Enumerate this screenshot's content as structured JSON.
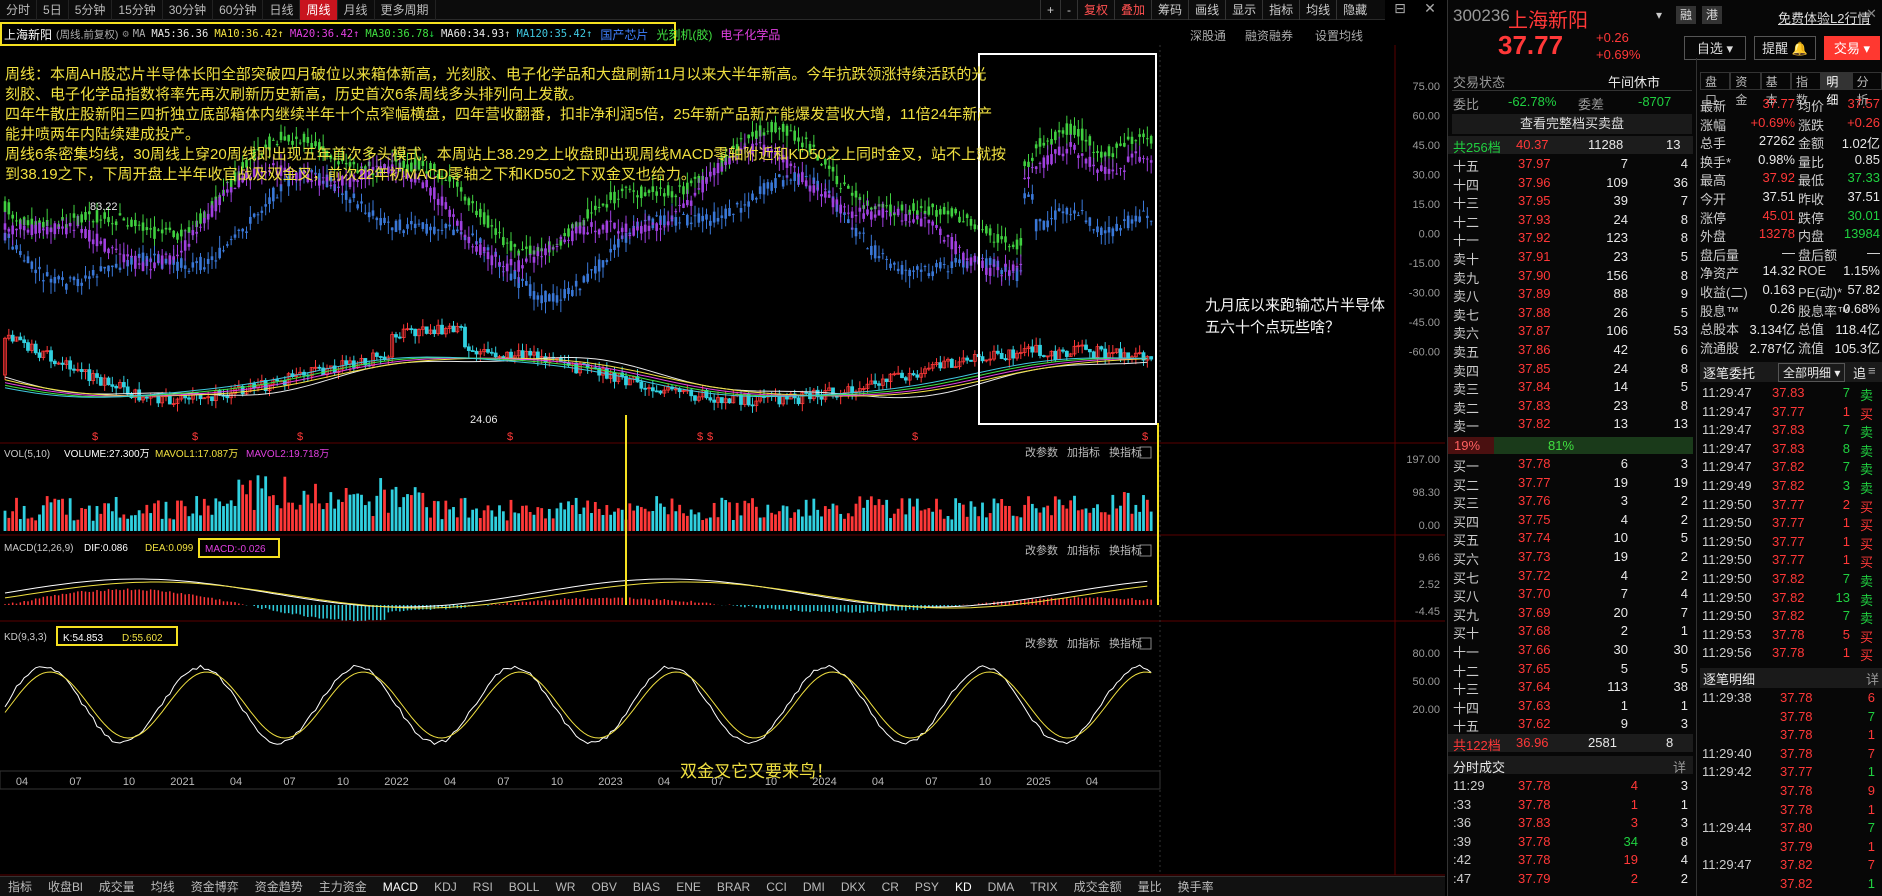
{
  "periods": [
    "分时",
    "5日",
    "5分钟",
    "15分钟",
    "30分钟",
    "60分钟",
    "日线",
    "周线",
    "月线",
    "更多周期"
  ],
  "active_period": "周线",
  "right_tools": [
    "+",
    "-",
    "复权",
    "叠加",
    "筹码",
    "画线",
    "显示",
    "指标",
    "均线",
    "隐藏"
  ],
  "ma_line": {
    "name": "上海新阳",
    "mode": "(周线,前复权)",
    "ma5": "MA5:36.36",
    "ma10": "MA10:36.42",
    "ma20": "MA20:36.42",
    "ma30": "MA30:36.78",
    "ma60": "MA60:34.93",
    "ma120": "MA120:35.42"
  },
  "concept_tags": [
    "国产芯片",
    "光刻机(胶)",
    "电子化学品"
  ],
  "chart_top_links": [
    "深股通",
    "融资融券",
    "设置均线"
  ],
  "annotation_lines": [
    "周线：本周AH股芯片半导体长阳全部突破四月破位以来箱体新高，光刻胶、电子化学品和大盘刷新11月以来大半年新高。今年抗跌领涨持续活跃的光",
    "刻胶、电子化学品指数将率先再次刷新历史新高，历史首次6条周线多头排列向上发散。",
    "四年牛散庄股新阳三四折独立底部箱体内继续半年十个点窄幅横盘，四年营收翻番，扣非净利润5倍，25年新产品新产能爆发营收大增，11倍24年新产",
    "能井喷两年内陆续建成投产。",
    "周线6条密集均线，30周线上穿20周线即出现五年首次多头模式，本周站上38.29之上收盘即出现周线MACD零轴附近和KD50之上同时金叉，站不上就按",
    "到38.19之下，下周开盘上半年收官战及双金叉，前次22年初MACD零轴之下和KD50之下双金叉也给力。"
  ],
  "note_box": "九月底以来跑输芯片半导体五六十个点玩些啥？",
  "note_kd": "双金叉它又要来鸟！",
  "price_labels": {
    "high": "83.22",
    "low": "24.06"
  },
  "overlay_axis": [
    "75.00",
    "60.00",
    "45.00",
    "30.00",
    "15.00",
    "0.00",
    "-15.00",
    "-30.00",
    "-45.00",
    "-60.00"
  ],
  "vol": {
    "title": "VOL(5,10)",
    "volume": "VOLUME:27.300万",
    "mavol1": "MAVOL1:17.087万",
    "mavol2": "MAVOL2:19.718万",
    "axis": [
      "197.00",
      "98.30",
      "0.00"
    ]
  },
  "macd": {
    "title": "MACD(12,26,9)",
    "dif": "DIF:0.086",
    "dea": "DEA:0.099",
    "macd": "MACD:-0.026",
    "axis": [
      "9.66",
      "2.52",
      "-4.45"
    ]
  },
  "kd": {
    "title": "KD(9,3,3)",
    "k": "K:54.853",
    "d": "D:55.602",
    "axis": [
      "80.00",
      "50.00",
      "20.00"
    ]
  },
  "sub_links": [
    "改参数",
    "加指标",
    "换指标"
  ],
  "years": [
    {
      "t": "04"
    },
    {
      "t": "07"
    },
    {
      "t": "10"
    },
    {
      "t": "2021"
    },
    {
      "t": "04"
    },
    {
      "t": "07"
    },
    {
      "t": "10"
    },
    {
      "t": "2022"
    },
    {
      "t": "04"
    },
    {
      "t": "07"
    },
    {
      "t": "10"
    },
    {
      "t": "2023"
    },
    {
      "t": "04"
    },
    {
      "t": "07"
    },
    {
      "t": "10"
    },
    {
      "t": "2024"
    },
    {
      "t": "04"
    },
    {
      "t": "07"
    },
    {
      "t": "10"
    },
    {
      "t": "2025"
    },
    {
      "t": "04"
    }
  ],
  "bottom_tabs": [
    "指标",
    "收盘Bl",
    "成交量",
    "均线",
    "资金博弈",
    "资金趋势",
    "主力资金",
    "MACD",
    "KDJ",
    "RSI",
    "BOLL",
    "WR",
    "OBV",
    "BIAS",
    "ENE",
    "BRAR",
    "CCI",
    "DMI",
    "DKX",
    "CR",
    "PSY",
    "KD",
    "DMA",
    "TRIX",
    "成交金额",
    "量比",
    "换手率"
  ],
  "quote": {
    "code": "300236",
    "name": "上海新阳",
    "price": "37.77",
    "chg": "+0.26",
    "pct": "+0.69%",
    "badges": [
      "融",
      "港"
    ],
    "promo": "免费体验L2行情",
    "buttons": [
      "自选",
      "提醒",
      "交易"
    ],
    "status_label": "交易状态",
    "status_value": "午间休市",
    "tabs": [
      "盘口",
      "资金",
      "基本",
      "指数",
      "明细",
      "分析"
    ],
    "webi": "委比",
    "webi_val": "-62.78%",
    "wecha": "委差",
    "wecha_val": "-8707",
    "full_book": "查看完整档买卖盘",
    "sell_total": {
      "label": "共256档",
      "price": "40.37",
      "vol": "11288",
      "n": "13"
    },
    "buy_total": {
      "label": "共122档",
      "price": "36.96",
      "vol": "2581",
      "n": "8"
    },
    "ratio": {
      "sell": "19%",
      "buy": "81%"
    },
    "asks": [
      [
        "十五",
        "37.97",
        "7",
        "4"
      ],
      [
        "十四",
        "37.96",
        "109",
        "36"
      ],
      [
        "十三",
        "37.95",
        "39",
        "7"
      ],
      [
        "十二",
        "37.93",
        "24",
        "8"
      ],
      [
        "十一",
        "37.92",
        "123",
        "8"
      ],
      [
        "卖十",
        "37.91",
        "23",
        "5"
      ],
      [
        "卖九",
        "37.90",
        "156",
        "8"
      ],
      [
        "卖八",
        "37.89",
        "88",
        "9"
      ],
      [
        "卖七",
        "37.88",
        "26",
        "5"
      ],
      [
        "卖六",
        "37.87",
        "106",
        "53"
      ],
      [
        "卖五",
        "37.86",
        "42",
        "6"
      ],
      [
        "卖四",
        "37.85",
        "24",
        "8"
      ],
      [
        "卖三",
        "37.84",
        "14",
        "5"
      ],
      [
        "卖二",
        "37.83",
        "23",
        "8"
      ],
      [
        "卖一",
        "37.82",
        "13",
        "13"
      ]
    ],
    "bids": [
      [
        "买一",
        "37.78",
        "6",
        "3"
      ],
      [
        "买二",
        "37.77",
        "19",
        "19"
      ],
      [
        "买三",
        "37.76",
        "3",
        "2"
      ],
      [
        "买四",
        "37.75",
        "4",
        "2"
      ],
      [
        "买五",
        "37.74",
        "10",
        "5"
      ],
      [
        "买六",
        "37.73",
        "19",
        "2"
      ],
      [
        "买七",
        "37.72",
        "4",
        "2"
      ],
      [
        "买八",
        "37.70",
        "7",
        "4"
      ],
      [
        "买九",
        "37.69",
        "20",
        "7"
      ],
      [
        "买十",
        "37.68",
        "2",
        "1"
      ],
      [
        "十一",
        "37.66",
        "30",
        "30"
      ],
      [
        "十二",
        "37.65",
        "5",
        "5"
      ],
      [
        "十三",
        "37.64",
        "113",
        "38"
      ],
      [
        "十四",
        "37.63",
        "1",
        "1"
      ],
      [
        "十五",
        "37.62",
        "9",
        "3"
      ]
    ],
    "stats": [
      [
        "最新",
        "37.77",
        "均价",
        "37.57"
      ],
      [
        "涨幅",
        "+0.69%",
        "涨跌",
        "+0.26"
      ],
      [
        "总手",
        "27262",
        "金额",
        "1.02亿"
      ],
      [
        "换手*",
        "0.98%",
        "量比",
        "0.85"
      ],
      [
        "最高",
        "37.92",
        "最低",
        "37.33"
      ],
      [
        "今开",
        "37.51",
        "昨收",
        "37.51"
      ],
      [
        "涨停",
        "45.01",
        "跌停",
        "30.01"
      ],
      [
        "外盘",
        "13278",
        "内盘",
        "13984"
      ],
      [
        "盘后量",
        "—",
        "盘后额",
        "—"
      ],
      [
        "净资产",
        "14.32",
        "ROE",
        "1.15%"
      ],
      [
        "收益(二)",
        "0.163",
        "PE(动)*",
        "57.82"
      ],
      [
        "股息™",
        "0.26",
        "股息率™",
        "0.68%"
      ],
      [
        "总股本",
        "3.134亿",
        "总值",
        "118.4亿"
      ],
      [
        "流通股",
        "2.787亿",
        "流值",
        "105.3亿"
      ]
    ],
    "tick_title": "逐笔委托",
    "tick_filter": "全部明细",
    "tick_chase": "追",
    "ticks": [
      [
        "11:29:47",
        "37.83",
        "7",
        "卖"
      ],
      [
        "11:29:47",
        "37.77",
        "1",
        "买"
      ],
      [
        "11:29:47",
        "37.83",
        "7",
        "卖"
      ],
      [
        "11:29:47",
        "37.83",
        "8",
        "卖"
      ],
      [
        "11:29:47",
        "37.82",
        "7",
        "卖"
      ],
      [
        "11:29:49",
        "37.82",
        "3",
        "卖"
      ],
      [
        "11:29:50",
        "37.77",
        "2",
        "买"
      ],
      [
        "11:29:50",
        "37.77",
        "1",
        "买"
      ],
      [
        "11:29:50",
        "37.77",
        "1",
        "买"
      ],
      [
        "11:29:50",
        "37.77",
        "1",
        "买"
      ],
      [
        "11:29:50",
        "37.82",
        "7",
        "卖"
      ],
      [
        "11:29:50",
        "37.82",
        "13",
        "卖"
      ],
      [
        "11:29:50",
        "37.82",
        "7",
        "卖"
      ],
      [
        "11:29:53",
        "37.78",
        "5",
        "买"
      ],
      [
        "11:29:56",
        "37.78",
        "1",
        "买"
      ]
    ],
    "detail_title": "逐笔明细",
    "details": [
      [
        "11:29:38",
        "37.78",
        "6"
      ],
      [
        "",
        "37.78",
        "7"
      ],
      [
        "",
        "37.78",
        "1"
      ],
      [
        "11:29:40",
        "37.78",
        "7"
      ],
      [
        "11:29:42",
        "37.77",
        "1"
      ],
      [
        "",
        "37.78",
        "9"
      ],
      [
        "",
        "37.78",
        "1"
      ],
      [
        "11:29:44",
        "37.80",
        "7"
      ],
      [
        "",
        "37.79",
        "1"
      ],
      [
        "11:29:47",
        "37.82",
        "7"
      ],
      [
        "",
        "37.82",
        "1"
      ]
    ],
    "fs_title": "分时成交",
    "more": "详",
    "fs": [
      [
        "11:29",
        "37.78",
        "4",
        "3"
      ],
      [
        ":33",
        "37.78",
        "1",
        "1"
      ],
      [
        ":36",
        "37.83",
        "3",
        "3"
      ],
      [
        ":39",
        "37.78",
        "34",
        "8"
      ],
      [
        ":42",
        "37.78",
        "19",
        "4"
      ],
      [
        ":47",
        "37.79",
        "2",
        "2"
      ]
    ]
  },
  "colors": {
    "up": "#ff3838",
    "down": "#20d040",
    "accent": "#f5e020"
  },
  "chart_data": {
    "type": "candlestick",
    "title": "上海新阳 周线",
    "price_ylim": [
      24.06,
      83.22
    ],
    "overlay_indices": [
      "国产芯片",
      "光刻机(胶)",
      "电子化学品"
    ],
    "overlay_ylim": [
      -60,
      75
    ],
    "series": [
      {
        "name": "MA5",
        "value": 36.36
      },
      {
        "name": "MA10",
        "value": 36.42
      },
      {
        "name": "MA20",
        "value": 36.42
      },
      {
        "name": "MA30",
        "value": 36.78
      },
      {
        "name": "MA60",
        "value": 34.93
      },
      {
        "name": "MA120",
        "value": 35.42
      }
    ],
    "x_ticks": [
      "04",
      "07",
      "10",
      "2021",
      "04",
      "07",
      "10",
      "2022",
      "04",
      "07",
      "10",
      "2023",
      "04",
      "07",
      "10",
      "2024",
      "04",
      "07",
      "10",
      "2025",
      "04"
    ],
    "vol_ylim": [
      0,
      197
    ],
    "macd_ylim": [
      -4.45,
      9.66
    ],
    "kd_ylim": [
      20,
      80
    ]
  }
}
